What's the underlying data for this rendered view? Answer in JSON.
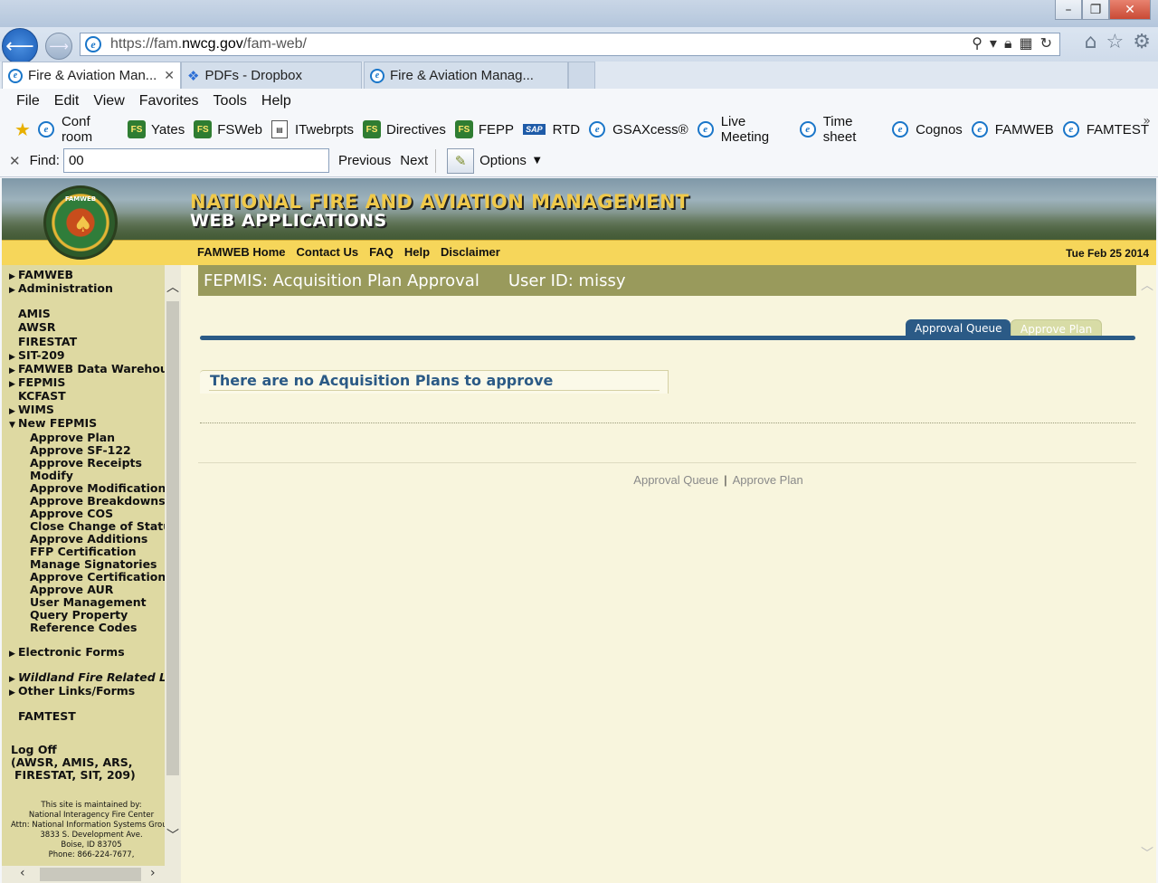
{
  "browser": {
    "url_prefix": "https://fam.",
    "url_domain": "nwcg.gov",
    "url_path": "/fam-web/",
    "tabs": [
      {
        "label": "Fire & Aviation Man...",
        "active": true
      },
      {
        "label": "PDFs - Dropbox",
        "active": false
      },
      {
        "label": "Fire & Aviation Manag...",
        "active": false
      }
    ],
    "menu": [
      "File",
      "Edit",
      "View",
      "Favorites",
      "Tools",
      "Help"
    ],
    "favorites": [
      "Conf room",
      "Yates",
      "FSWeb",
      "ITwebrpts",
      "Directives",
      "FEPP",
      "RTD",
      "GSAXcess®",
      "Live Meeting",
      "Time sheet",
      "Cognos",
      "FAMWEB",
      "FAMTEST"
    ],
    "find": {
      "label": "Find:",
      "value": "00",
      "previous": "Previous",
      "next": "Next",
      "options": "Options"
    },
    "icons": {
      "back": "back-arrow-icon",
      "forward": "forward-arrow-icon",
      "home": "home-icon",
      "favorites": "star-icon",
      "settings": "gear-icon"
    }
  },
  "banner": {
    "title1": "NATIONAL FIRE AND AVIATION MANAGEMENT",
    "title2": "WEB APPLICATIONS",
    "logo_text": "FAMWEB"
  },
  "topnav": {
    "links": [
      "FAMWEB Home",
      "Contact Us",
      "FAQ",
      "Help",
      "Disclaimer"
    ],
    "date": "Tue Feb 25 2014"
  },
  "sidebar": {
    "famweb": "FAMWEB",
    "administration": "Administration",
    "amis": "AMIS",
    "awsr": "AWSR",
    "firestat": "FIRESTAT",
    "sit209": "SIT-209",
    "warehouse": "FAMWEB Data Warehouse",
    "fepmis": "FEPMIS",
    "kcfast": "KCFAST",
    "wims": "WIMS",
    "newfepmis": "New FEPMIS",
    "sub": [
      "Approve Plan",
      "Approve SF-122",
      "Approve Receipts",
      "Modify",
      "Approve Modifications",
      "Approve Breakdowns",
      "Approve COS",
      "Close Change of Status",
      "Approve Additions",
      "FFP Certification",
      "Manage Signatories",
      "Approve Certification",
      "Approve AUR",
      "User Management",
      "Query Property",
      "Reference Codes"
    ],
    "electronic_forms": "Electronic Forms",
    "wildland": "Wildland Fire Related Links",
    "other_links": "Other Links/Forms",
    "famtest": "FAMTEST",
    "logoff": "Log Off",
    "logoff_line2": "(AWSR, AMIS, ARS,",
    "logoff_line3": "FIRESTAT, SIT, 209)",
    "maintained": [
      "This site is maintained by:",
      "National Interagency Fire Center",
      "Attn: National Information Systems Group",
      "3833 S. Development Ave.",
      "Boise, ID 83705",
      "Phone: 866-224-7677,"
    ]
  },
  "main": {
    "header_title": "FEPMIS: Acquisition Plan Approval",
    "header_user": "User ID: missy",
    "tab_active": "Approval Queue",
    "tab_inactive": "Approve Plan",
    "message": "There are no Acquisition Plans to approve",
    "footer_link1": "Approval Queue",
    "footer_sep": "|",
    "footer_link2": "Approve Plan"
  }
}
